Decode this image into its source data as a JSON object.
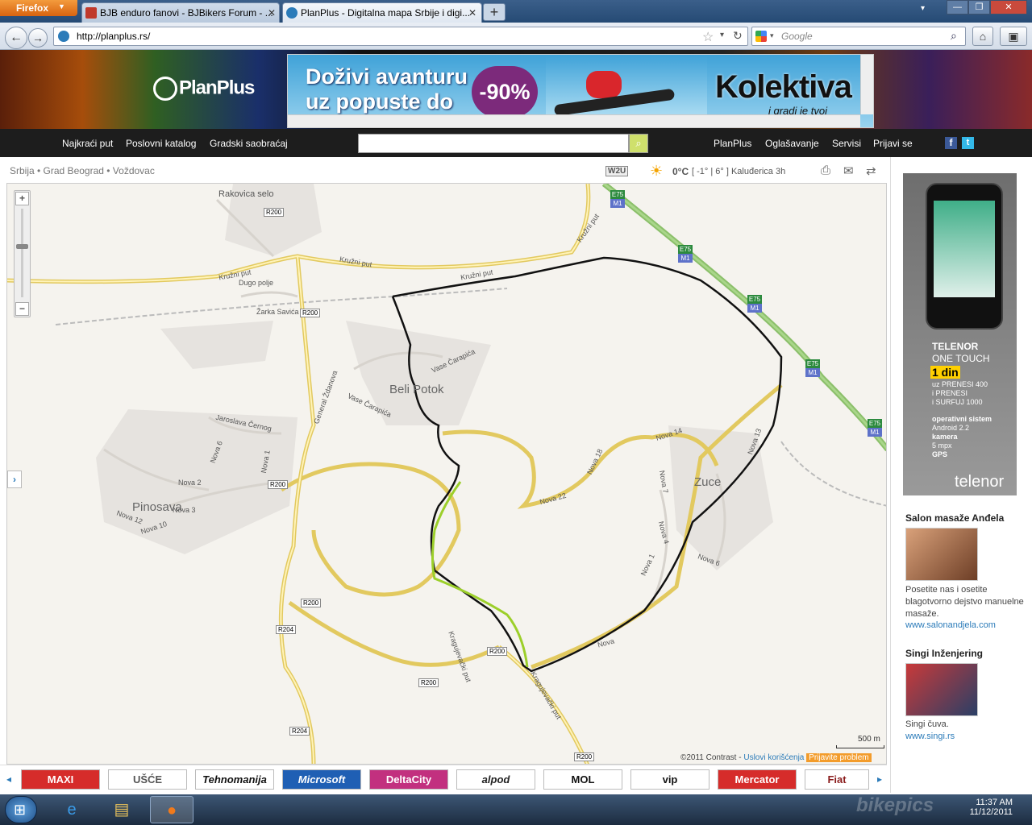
{
  "browser": {
    "firefox_button": "Firefox",
    "tabs": [
      {
        "label": "BJB enduro fanovi - BJBikers Forum - ..."
      },
      {
        "label": "PlanPlus - Digitalna mapa Srbije i digi..."
      }
    ],
    "new_tab": "+",
    "url": "http://planplus.rs/",
    "search_placeholder": "Google"
  },
  "site": {
    "logo": "PlanPlus",
    "banner": {
      "headline_line1": "Doživi avanturu",
      "headline_line2": "uz popuste do",
      "discount": "-90%",
      "brand": "Kolektiva",
      "tagline": "i gradi je tvoj"
    },
    "menu_left": [
      "Najkraći put",
      "Poslovni katalog",
      "Gradski saobraćaj"
    ],
    "menu_right": [
      "PlanPlus",
      "Oglašavanje",
      "Servisi",
      "Prijavi se"
    ],
    "breadcrumb": "Srbija • Grad Beograd • Voždovac",
    "weather": {
      "logo": "W2U",
      "temp": "0°C",
      "details": "[ -1° | 6° ] Kaluđerica 3h"
    }
  },
  "map": {
    "scale_label": "500 m",
    "copyright": "©2011 Contrast -",
    "terms_link": "Uslovi korišćenja",
    "report_button": "Prijavite problem",
    "zoom_in": "+",
    "zoom_out": "−",
    "side_arrow": "›",
    "places": [
      {
        "name": "Rakovica selo",
        "size": "small"
      },
      {
        "name": "Dugo polje",
        "size": "small"
      },
      {
        "name": "Žarka Savića",
        "size": "small"
      },
      {
        "name": "Beli Potok",
        "size": "large"
      },
      {
        "name": "Vase Čarapića",
        "size": "small"
      },
      {
        "name": "Vase Čarapića",
        "size": "small"
      },
      {
        "name": "Jaroslava Černog",
        "size": "small"
      },
      {
        "name": "General Ždanova",
        "size": "small"
      },
      {
        "name": "Pinosava",
        "size": "large"
      },
      {
        "name": "Nova 2",
        "size": "small"
      },
      {
        "name": "Nova 6",
        "size": "small"
      },
      {
        "name": "Nova 1",
        "size": "small"
      },
      {
        "name": "Nova 3",
        "size": "small"
      },
      {
        "name": "Nova 10",
        "size": "small"
      },
      {
        "name": "Nova 12",
        "size": "small"
      },
      {
        "name": "Nova 22",
        "size": "small"
      },
      {
        "name": "Nova 18",
        "size": "small"
      },
      {
        "name": "Nova 14",
        "size": "small"
      },
      {
        "name": "Nova 13",
        "size": "small"
      },
      {
        "name": "Nova 7",
        "size": "small"
      },
      {
        "name": "Nova 4",
        "size": "small"
      },
      {
        "name": "Nova 6",
        "size": "small"
      },
      {
        "name": "Nova 1",
        "size": "small"
      },
      {
        "name": "Zuce",
        "size": "large"
      },
      {
        "name": "Kružni put",
        "size": "small"
      },
      {
        "name": "Kružni put",
        "size": "small"
      },
      {
        "name": "Kružni put",
        "size": "small"
      },
      {
        "name": "Kružni put",
        "size": "small"
      },
      {
        "name": "Kragujevački put",
        "size": "small"
      },
      {
        "name": "Kragujevački put",
        "size": "small"
      },
      {
        "name": "Nova",
        "size": "small"
      }
    ],
    "road_shields": [
      "R200",
      "R200",
      "R200",
      "R200",
      "R200",
      "R200",
      "R200",
      "R204",
      "R204",
      "R200"
    ],
    "highway_shields": [
      {
        "top": "E75",
        "bottom": "M1"
      },
      {
        "top": "E75",
        "bottom": "M1"
      },
      {
        "top": "E75",
        "bottom": "M1"
      },
      {
        "top": "E75",
        "bottom": "M1"
      },
      {
        "top": "E75",
        "bottom": "M1"
      }
    ]
  },
  "sidebar": {
    "telenor_ad": {
      "brand": "TELENOR",
      "model": "ONE TOUCH",
      "price": "1 din",
      "line1": "uz PRENESI 400",
      "line2": "i PRENESI",
      "line3": "i SURFUJ 1000",
      "os_label": "operativni sistem",
      "os": "Android 2.2",
      "camera_label": "kamera",
      "camera": "5 mpx",
      "gps": "GPS",
      "logo": "telenor"
    },
    "ads": [
      {
        "title": "Salon masaže Anđela",
        "text": "Posetite nas i osetite blagotvorno dejstvo manuelne masaže.",
        "link": "www.salonandjela.com"
      },
      {
        "title": "Singi Inženjering",
        "text": "Singi čuva.",
        "link": "www.singi.rs"
      }
    ]
  },
  "brands": [
    "MAXI",
    "UŠĆE",
    "Tehnomanija",
    "Microsoft",
    "DeltaCity",
    "alpod",
    "MOL",
    "vip",
    "Mercator",
    "Fiat"
  ],
  "taskbar": {
    "time": "11:37 AM",
    "date": "11/12/2011",
    "watermark": "bikepics"
  }
}
